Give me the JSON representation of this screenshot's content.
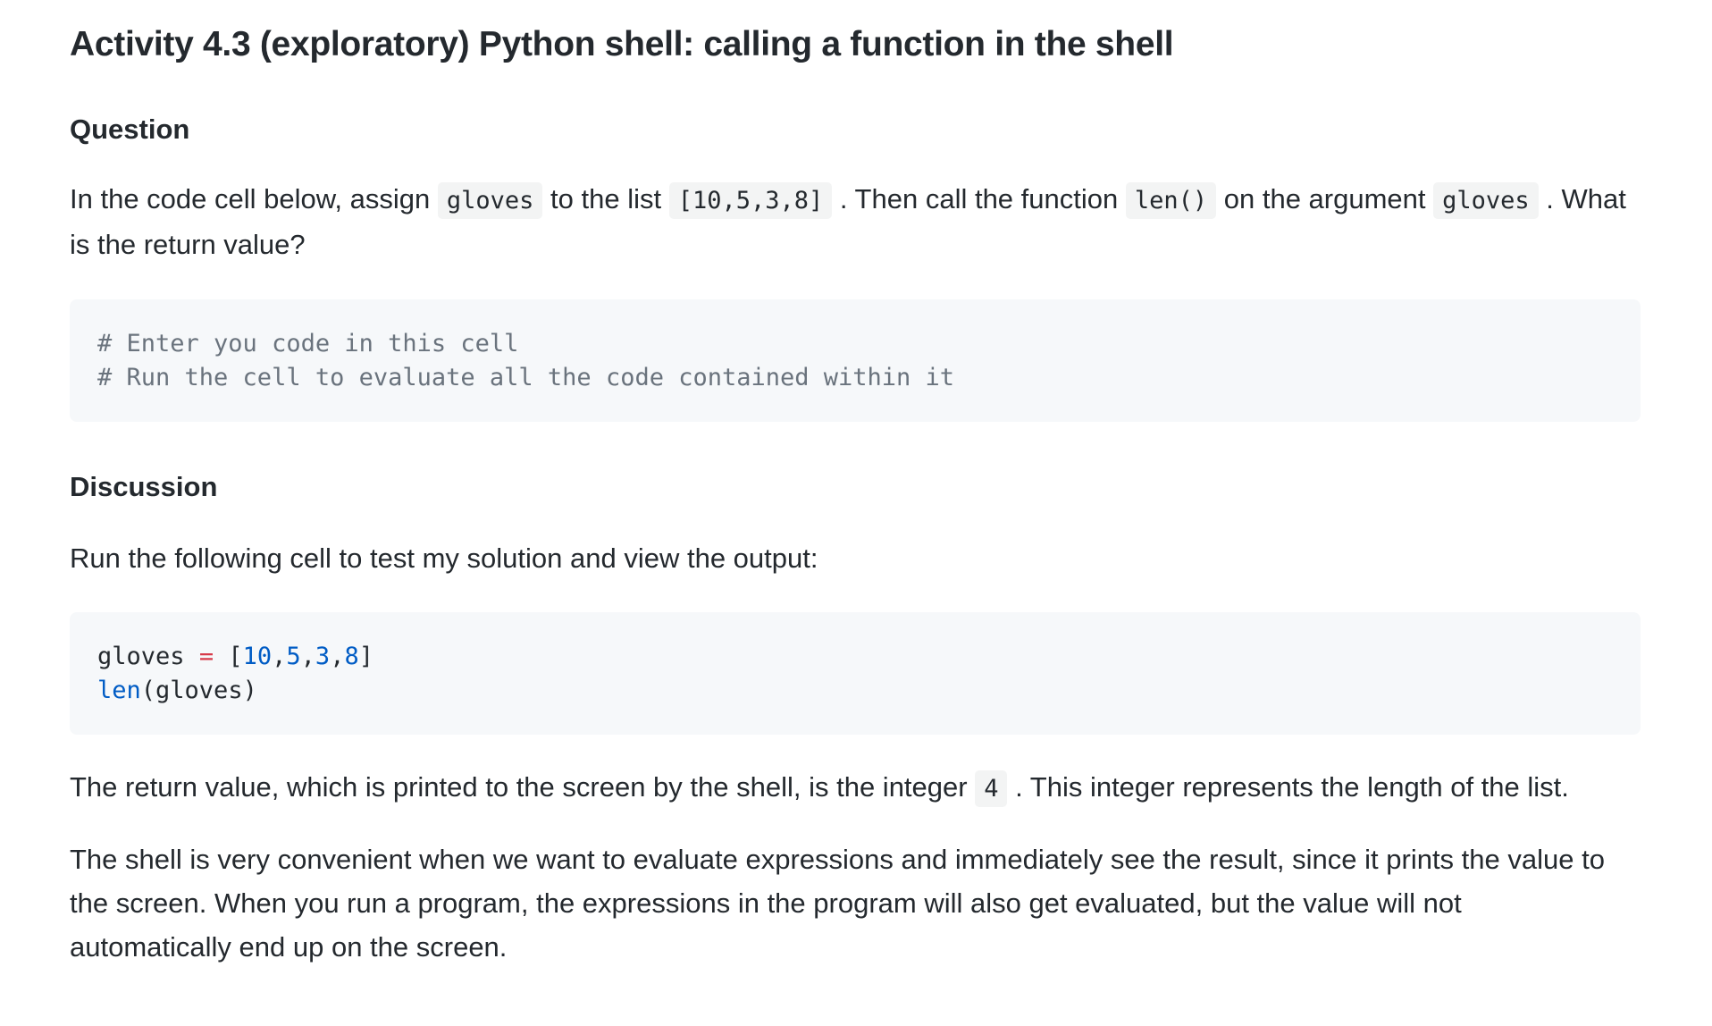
{
  "title": "Activity 4.3 (exploratory) Python shell: calling a function in the shell",
  "question": {
    "heading": "Question",
    "text_1": "In the code cell below, assign ",
    "code_1": "gloves",
    "text_2": " to the list ",
    "code_2": "[10,5,3,8]",
    "text_3": " . Then call the function ",
    "code_3": "len()",
    "text_4": " on the argument ",
    "code_4": "gloves",
    "text_5": " . What is the return value?"
  },
  "code_cell_1": {
    "line_1": "# Enter you code in this cell",
    "line_2": "# Run the cell to evaluate all the code contained within it"
  },
  "discussion": {
    "heading": "Discussion",
    "intro": "Run the following cell to test my solution and view the output:"
  },
  "code_cell_2": {
    "var": "gloves",
    "op": "=",
    "bracket_open": "[",
    "num_1": "10",
    "num_2": "5",
    "num_3": "3",
    "num_4": "8",
    "comma": ",",
    "bracket_close": "]",
    "func": "len",
    "call_args": "(gloves)"
  },
  "result": {
    "text_1": "The return value, which is printed to the screen by the shell, is the integer ",
    "code_1": "4",
    "text_2": " . This integer represents the length of the list."
  },
  "summary": {
    "text": "The shell is very convenient when we want to evaluate expressions and immediately see the result, since it prints the value to the screen. When you run a program, the expressions in the program will also get evaluated, but the value will not automatically end up on the screen."
  }
}
